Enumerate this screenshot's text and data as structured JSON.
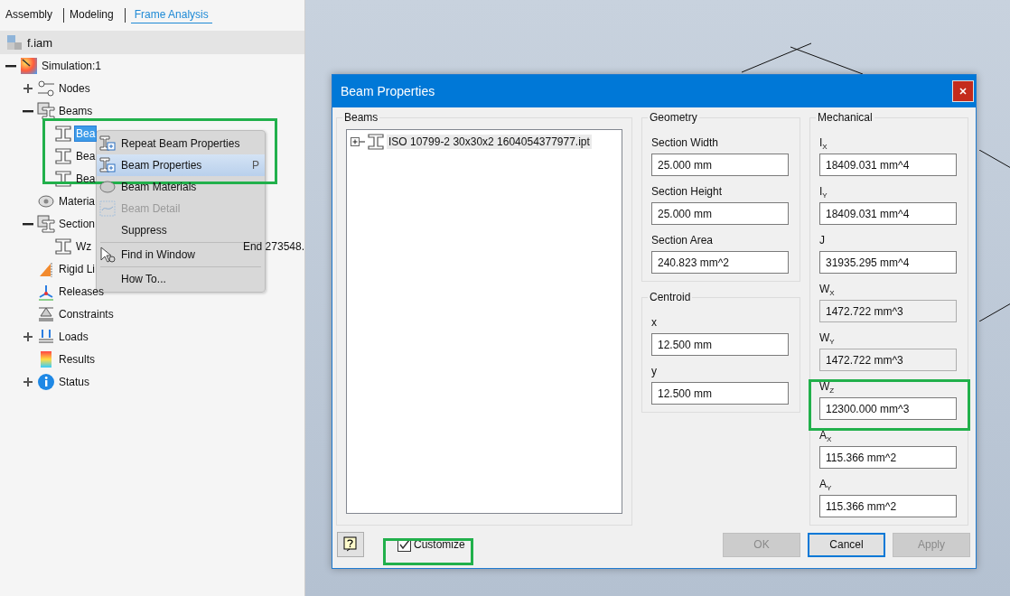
{
  "tabs": [
    {
      "label": "Assembly",
      "selected": false
    },
    {
      "label": "Modeling",
      "selected": false
    },
    {
      "label": "Frame Analysis",
      "selected": true
    }
  ],
  "browser": {
    "root": {
      "label": "f.iam",
      "kind": "assembly"
    },
    "tree": [
      {
        "label": "Simulation:1",
        "kind": "simulation",
        "expanded": true,
        "selected": false,
        "children": [
          {
            "label": "Nodes",
            "kind": "nodes",
            "expanded": false,
            "selected": false
          },
          {
            "label": "Beams",
            "kind": "beams",
            "expanded": true,
            "selected": false,
            "children": [
              {
                "label": "Bea",
                "kind": "beam",
                "selected": true
              },
              {
                "label": "Bea",
                "kind": "beam",
                "selected": false
              },
              {
                "label": "Bea",
                "kind": "beam",
                "selected": false
              }
            ]
          },
          {
            "label": "Materia",
            "kind": "materials",
            "selected": false
          },
          {
            "label": "Section",
            "kind": "sections",
            "expanded": true,
            "selected": false,
            "children": [
              {
                "label": "Wz",
                "trailing": "End 273548.",
                "kind": "beam",
                "selected": false
              }
            ]
          },
          {
            "label": "Rigid Li",
            "kind": "rigid",
            "selected": false
          },
          {
            "label": "Releases",
            "kind": "releases",
            "selected": false
          },
          {
            "label": "Constraints",
            "kind": "constraints",
            "selected": false
          },
          {
            "label": "Loads",
            "kind": "loads",
            "expanded": false,
            "selected": false
          },
          {
            "label": "Results",
            "kind": "results",
            "selected": false
          },
          {
            "label": "Status",
            "kind": "status",
            "expanded": false,
            "selected": false
          }
        ]
      }
    ]
  },
  "context_menu": [
    {
      "label": "Repeat Beam Properties",
      "kind": "beam",
      "selected": false,
      "disabled": false
    },
    {
      "label": "Beam Properties",
      "kind": "beam",
      "selected": true,
      "disabled": false,
      "shortcut": "P"
    },
    {
      "label": "Beam Materials",
      "kind": "material",
      "selected": false,
      "disabled": false
    },
    {
      "label": "Beam Detail",
      "kind": "detail",
      "selected": false,
      "disabled": true
    },
    {
      "label": "Suppress",
      "kind": "plain",
      "selected": false,
      "disabled": false
    },
    {
      "kind": "separator"
    },
    {
      "label": "Find in Window",
      "kind": "find",
      "selected": false,
      "disabled": false
    },
    {
      "kind": "separator"
    },
    {
      "label": "How To...",
      "kind": "plain",
      "selected": false,
      "disabled": false
    }
  ],
  "dialog": {
    "title": "Beam Properties",
    "beams": {
      "title": "Beams",
      "items": [
        {
          "label": "ISO 10799-2 30x30x2 1604054377977.ipt",
          "expanded": false
        }
      ]
    },
    "geometry": {
      "title": "Geometry",
      "fields": [
        {
          "label": "Section Width",
          "value": "25.000 mm",
          "readonly": false
        },
        {
          "label": "Section Height",
          "value": "25.000 mm",
          "readonly": false
        },
        {
          "label": "Section Area",
          "value": "240.823 mm^2",
          "readonly": false
        }
      ]
    },
    "centroid": {
      "title": "Centroid",
      "fields": [
        {
          "label": "x",
          "value": "12.500 mm",
          "readonly": false
        },
        {
          "label": "y",
          "value": "12.500 mm",
          "readonly": false
        }
      ]
    },
    "mechanical": {
      "title": "Mechanical",
      "fields": [
        {
          "label": "I$_{X}$",
          "value": "18409.031 mm^4",
          "readonly": false
        },
        {
          "label": "I$_{Y}$",
          "value": "18409.031 mm^4",
          "readonly": false
        },
        {
          "label": "J",
          "value": "31935.295 mm^4",
          "readonly": false
        },
        {
          "label": "W$_{X}$",
          "value": "1472.722 mm^3",
          "readonly": true
        },
        {
          "label": "W$_{Y}$",
          "value": "1472.722 mm^3",
          "readonly": true
        },
        {
          "label": "W$_{Z}$",
          "value": "12300.000 mm^3",
          "readonly": false
        },
        {
          "label": "A$_{X}$",
          "value": "115.366 mm^2",
          "readonly": false
        },
        {
          "label": "A$_{Y}$",
          "value": "115.366 mm^2",
          "readonly": false
        }
      ]
    },
    "customize": {
      "label": "Customize",
      "checked": true
    },
    "buttons": [
      {
        "label": "OK",
        "disabled": true,
        "default": false
      },
      {
        "label": "Cancel",
        "disabled": false,
        "default": true
      },
      {
        "label": "Apply",
        "disabled": true,
        "default": false
      }
    ]
  }
}
